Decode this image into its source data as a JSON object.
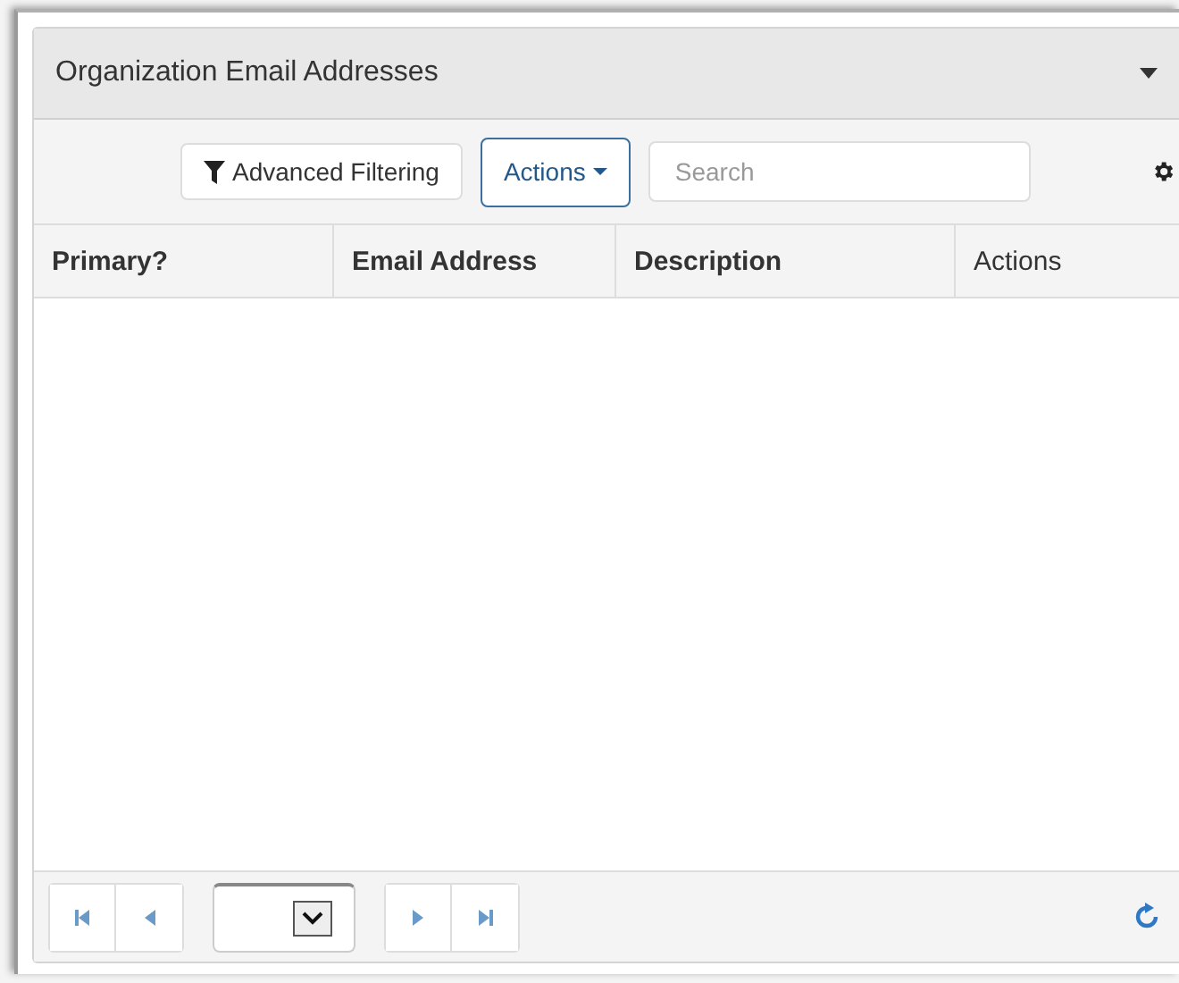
{
  "panel": {
    "title": "Organization Email Addresses",
    "expanded": true
  },
  "toolbar": {
    "filter_button": "Advanced Filtering",
    "actions_button": "Actions",
    "search": {
      "placeholder": "Search"
    }
  },
  "table": {
    "columns": [
      {
        "label": "Primary?",
        "bold": true
      },
      {
        "label": "Email Address",
        "bold": true
      },
      {
        "label": "Description",
        "bold": true
      },
      {
        "label": "Actions",
        "bold": false
      }
    ]
  }
}
